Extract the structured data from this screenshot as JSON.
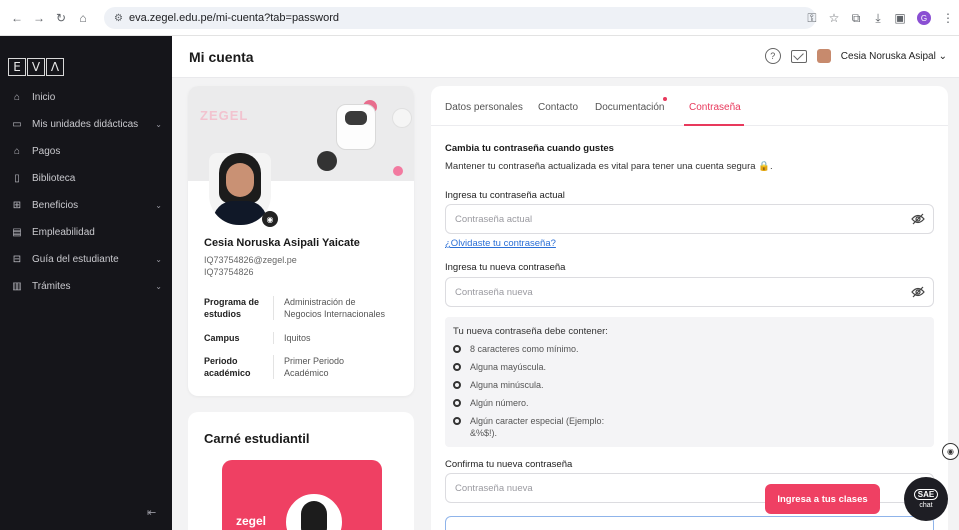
{
  "browser": {
    "url": "eva.zegel.edu.pe/mi-cuenta?tab=password",
    "profile_initial": "G"
  },
  "sidebar": {
    "logo_letters": [
      "E",
      "V",
      "Λ"
    ],
    "items": [
      {
        "label": "Inicio",
        "icon": "home-icon",
        "has_chevron": false
      },
      {
        "label": "Mis unidades didácticas",
        "icon": "book-icon",
        "has_chevron": true
      },
      {
        "label": "Pagos",
        "icon": "bank-icon",
        "has_chevron": false
      },
      {
        "label": "Biblioteca",
        "icon": "library-icon",
        "has_chevron": false
      },
      {
        "label": "Beneficios",
        "icon": "grid-icon",
        "has_chevron": true
      },
      {
        "label": "Empleabilidad",
        "icon": "briefcase-icon",
        "has_chevron": false
      },
      {
        "label": "Guía del estudiante",
        "icon": "guide-icon",
        "has_chevron": true
      },
      {
        "label": "Trámites",
        "icon": "document-icon",
        "has_chevron": true
      }
    ]
  },
  "header": {
    "title": "Mi cuenta",
    "user_name": "Cesia Noruska Asipal",
    "help_symbol": "?"
  },
  "profile": {
    "banner_logo": "ZEGEL",
    "name": "Cesia Noruska Asipali Yaicate",
    "email": "IQ73754826@zegel.pe",
    "code": "IQ73754826",
    "fields": [
      {
        "key": [
          "Programa de",
          "estudios"
        ],
        "value": [
          "Administración de",
          "Negocios Internacionales"
        ]
      },
      {
        "key": [
          "Campus"
        ],
        "value": [
          "Iquitos"
        ]
      },
      {
        "key": [
          "Periodo",
          "académico"
        ],
        "value": [
          "Primer Periodo",
          "Académico"
        ]
      }
    ]
  },
  "carnet": {
    "title": "Carné estudiantil",
    "logo": "zegel"
  },
  "tabs": [
    {
      "label": "Datos personales",
      "active": false
    },
    {
      "label": "Contacto",
      "active": false
    },
    {
      "label": "Documentación",
      "active": false
    },
    {
      "label": "Contraseña",
      "active": true
    }
  ],
  "form": {
    "heading": "Cambia tu contraseña cuando gustes",
    "description": "Mantener tu contraseña actualizada es vital para tener una cuenta segura 🔒.",
    "current_label": "Ingresa tu contraseña actual",
    "current_placeholder": "Contraseña actual",
    "forgot_link": "¿Olvidaste tu contraseña?",
    "new_label": "Ingresa tu nueva contraseña",
    "new_placeholder": "Contraseña nueva",
    "requirements_title": "Tu nueva contraseña debe contener:",
    "requirements": [
      [
        "8 caracteres como mínimo."
      ],
      [
        "Alguna mayúscula."
      ],
      [
        "Alguna minúscula."
      ],
      [
        "Algún número."
      ],
      [
        "Algún caracter especial (Ejemplo:",
        "&%$!)."
      ]
    ],
    "confirm_label": "Confirma tu nueva contraseña",
    "confirm_placeholder": "Contraseña nueva"
  },
  "floating": {
    "cta_label": "Ingresa a tus clases",
    "chat_badge": "SAE",
    "chat_label": "chat"
  },
  "colors": {
    "accent": "#e8395c",
    "sidebar_bg": "#15151a",
    "cta_bg": "#ef4063"
  }
}
